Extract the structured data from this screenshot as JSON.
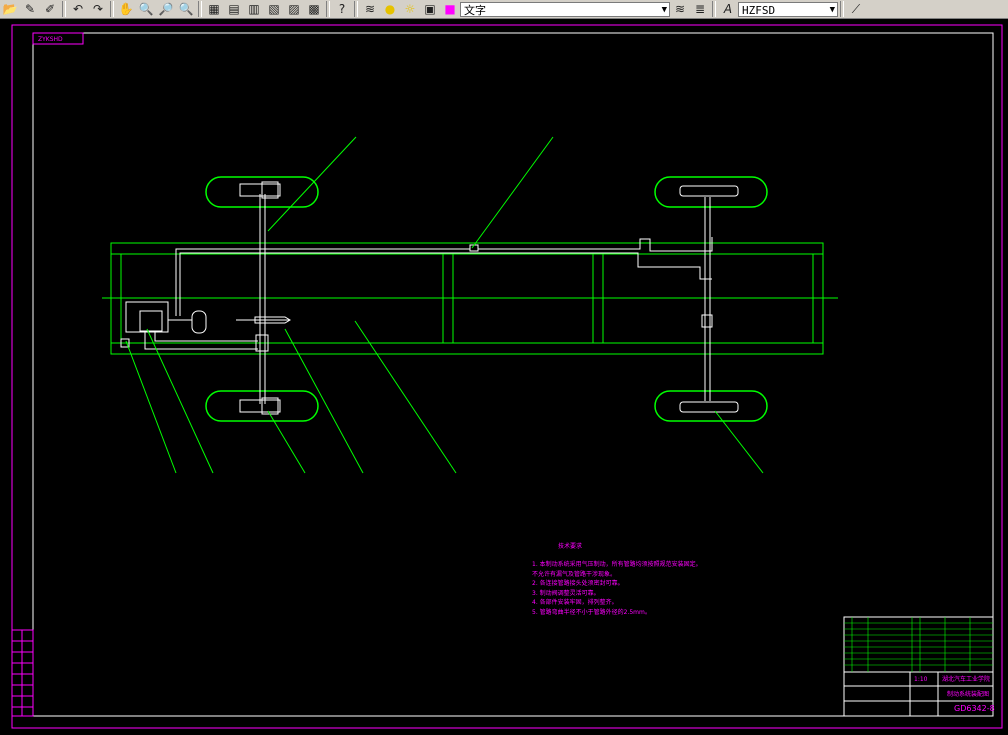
{
  "toolbar": {
    "tools": [
      {
        "name": "open-icon",
        "glyph": "📂"
      },
      {
        "name": "pencil-icon",
        "glyph": "✎"
      },
      {
        "name": "highlighter-icon",
        "glyph": "✐"
      },
      {
        "name": "undo-icon",
        "glyph": "↶"
      },
      {
        "name": "redo-icon",
        "glyph": "↷"
      },
      {
        "name": "pan-icon",
        "glyph": "✋"
      },
      {
        "name": "zoom-realtime-icon",
        "glyph": "🔍"
      },
      {
        "name": "zoom-window-icon",
        "glyph": "🔎"
      },
      {
        "name": "zoom-previous-icon",
        "glyph": "🔍"
      },
      {
        "name": "properties-icon",
        "glyph": "▦"
      },
      {
        "name": "design-center-icon",
        "glyph": "▤"
      },
      {
        "name": "tool-palette-icon",
        "glyph": "▥"
      },
      {
        "name": "sheet-set-icon",
        "glyph": "▧"
      },
      {
        "name": "markup-icon",
        "glyph": "▨"
      },
      {
        "name": "calculator-icon",
        "glyph": "▩"
      },
      {
        "name": "help-icon",
        "glyph": "?"
      }
    ],
    "layer_value": "文字",
    "layer_state_icons": [
      "lightbulb-icon",
      "sun-icon",
      "lock-icon",
      "color-swatch-icon"
    ],
    "text_style_value": "HZFSD"
  },
  "colors": {
    "background": "#000000",
    "frame": "#ff00ff",
    "chassis": "#00ff00",
    "brake_lines": "#ffffff",
    "annotation": "#ff00ff"
  },
  "drawing": {
    "corner_label": "ZYKSHD",
    "notes_title": "技术要求",
    "notes": [
      "1. 本制动系统采用气压制动，所有管路均须按照规范安装固定。",
      "不允许有漏气及管路干涉现象。",
      "2. 各连接管路接头处须密封可靠。",
      "3. 制动阀调整灵活可靠。",
      "4. 各部件安装牢固，排列整齐。",
      "5. 管路弯曲半径不小于管路外径的2.5mm。"
    ],
    "title_block": {
      "drawing_number": "GD6342-8",
      "part_name": "制动系统装配图",
      "school": "湖北汽车工业学院",
      "scale": "1:10"
    }
  }
}
